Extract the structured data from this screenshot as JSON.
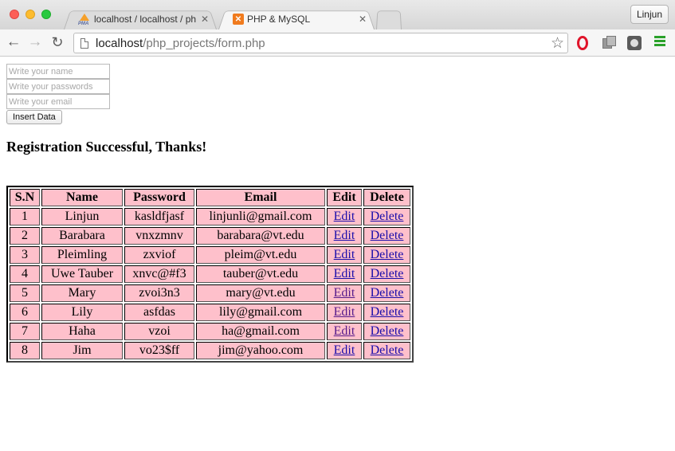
{
  "browser": {
    "tabs": [
      {
        "title": "localhost / localhost / php /",
        "active": false
      },
      {
        "title": "PHP & MySQL",
        "active": true
      }
    ],
    "profile": "Linjun",
    "url_host": "localhost",
    "url_path": "/php_projects/form.php"
  },
  "form": {
    "name_placeholder": "Write your name",
    "password_placeholder": "Write your passwords",
    "email_placeholder": "Write your email",
    "submit_label": "Insert Data"
  },
  "message": "Registration Successful, Thanks!",
  "table": {
    "headers": [
      "S.N",
      "Name",
      "Password",
      "Email",
      "Edit",
      "Delete"
    ],
    "rows": [
      {
        "sn": "1",
        "name": "Linjun",
        "password": "kasldfjasf",
        "email": "linjunli@gmail.com",
        "edit": "Edit",
        "delete": "Delete",
        "edit_visited": false
      },
      {
        "sn": "2",
        "name": "Barabara",
        "password": "vnxzmnv",
        "email": "barabara@vt.edu",
        "edit": "Edit",
        "delete": "Delete",
        "edit_visited": false
      },
      {
        "sn": "3",
        "name": "Pleimling",
        "password": "zxviof",
        "email": "pleim@vt.edu",
        "edit": "Edit",
        "delete": "Delete",
        "edit_visited": false
      },
      {
        "sn": "4",
        "name": "Uwe Tauber",
        "password": "xnvc@#f3",
        "email": "tauber@vt.edu",
        "edit": "Edit",
        "delete": "Delete",
        "edit_visited": false
      },
      {
        "sn": "5",
        "name": "Mary",
        "password": "zvoi3n3",
        "email": "mary@vt.edu",
        "edit": "Edit",
        "delete": "Delete",
        "edit_visited": true
      },
      {
        "sn": "6",
        "name": "Lily",
        "password": "asfdas",
        "email": "lily@gmail.com",
        "edit": "Edit",
        "delete": "Delete",
        "edit_visited": true
      },
      {
        "sn": "7",
        "name": "Haha",
        "password": "vzoi",
        "email": "ha@gmail.com",
        "edit": "Edit",
        "delete": "Delete",
        "edit_visited": true
      },
      {
        "sn": "8",
        "name": "Jim",
        "password": "vo23$ff",
        "email": "jim@yahoo.com",
        "edit": "Edit",
        "delete": "Delete",
        "edit_visited": false
      }
    ]
  },
  "colors": {
    "table_cell_bg": "#fec0cb",
    "link": "#1a0dab",
    "visited_link": "#551a8b"
  }
}
